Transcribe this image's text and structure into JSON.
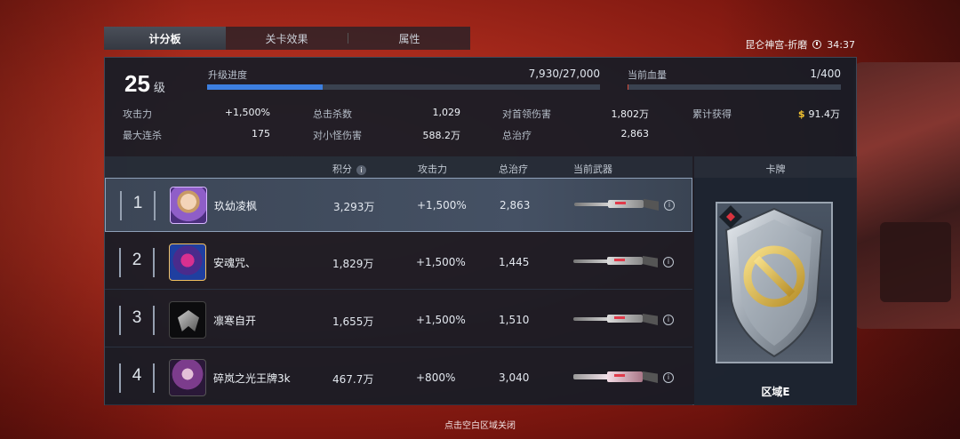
{
  "tabs": [
    {
      "label": "计分板",
      "active": true
    },
    {
      "label": "关卡效果",
      "active": false
    },
    {
      "label": "属性",
      "active": false
    }
  ],
  "header": {
    "stage": "昆仑神宫-折磨",
    "timer": "34:37"
  },
  "level": {
    "value": "25",
    "unit": "级"
  },
  "progress": {
    "label": "升级进度",
    "value": "7,930/27,000",
    "fraction": 0.2937
  },
  "hp": {
    "label": "当前血量",
    "value": "1/400",
    "fraction": 0.0025
  },
  "stats": {
    "attack": {
      "label": "攻击力",
      "value": "+1,500%"
    },
    "max_streak": {
      "label": "最大连杀",
      "value": "175"
    },
    "total_kills": {
      "label": "总击杀数",
      "value": "1,029"
    },
    "minion_damage": {
      "label": "对小怪伤害",
      "value": "588.2万"
    },
    "boss_damage": {
      "label": "对首领伤害",
      "value": "1,802万"
    },
    "total_heal": {
      "label": "总治疗",
      "value": "2,863"
    },
    "earned": {
      "label": "累计获得",
      "value": "91.4万"
    }
  },
  "table": {
    "headers": {
      "score": "积分",
      "attack": "攻击力",
      "heal": "总治疗",
      "weapon": "当前武器"
    },
    "rows": [
      {
        "rank": "1",
        "name": "玖幼凌枫",
        "score": "3,293万",
        "attack": "+1,500%",
        "heal": "2,863"
      },
      {
        "rank": "2",
        "name": "安魂咒、",
        "score": "1,829万",
        "attack": "+1,500%",
        "heal": "1,445"
      },
      {
        "rank": "3",
        "name": "凛寒自开",
        "score": "1,655万",
        "attack": "+1,500%",
        "heal": "1,510"
      },
      {
        "rank": "4",
        "name": "碎岚之光王牌3k",
        "score": "467.7万",
        "attack": "+800%",
        "heal": "3,040"
      }
    ]
  },
  "card": {
    "header": "卡牌",
    "name": "区域E"
  },
  "footer": {
    "hint": "点击空白区域关闭"
  },
  "colors": {
    "progress": "#3d7fe0",
    "coin": "#f2c230"
  }
}
